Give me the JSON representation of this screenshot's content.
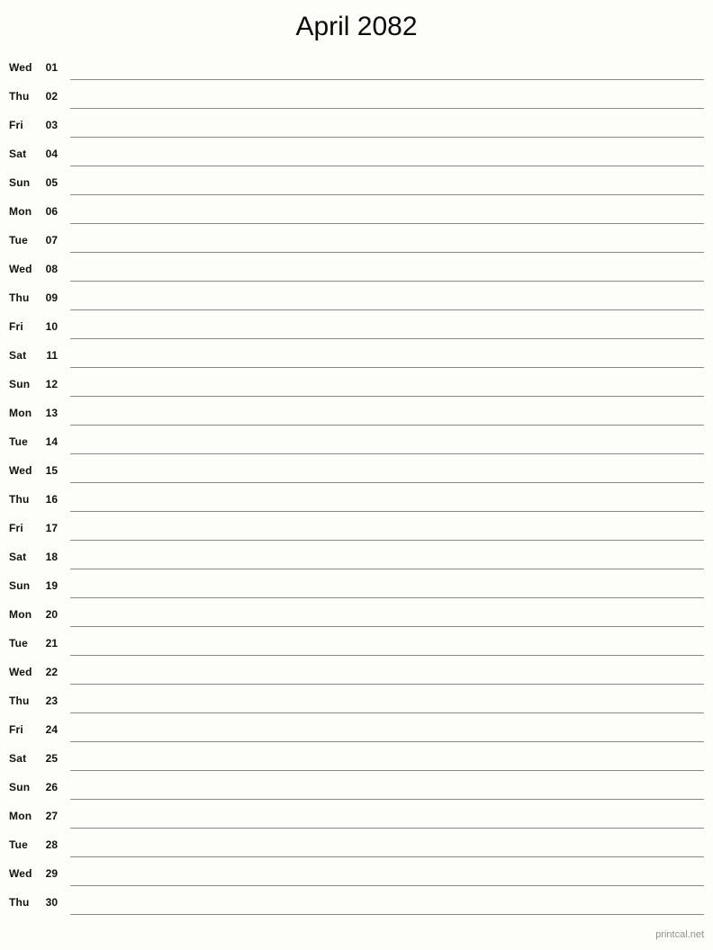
{
  "page": {
    "title": "April 2082",
    "background_color": "#fdfdfa",
    "rule_color": "#8a8a85",
    "text_color": "#111111",
    "footer_color": "#8f8f8f"
  },
  "footer": {
    "credit": "printcal.net"
  },
  "calendar": {
    "month_name": "April",
    "year": "2082",
    "days_in_month": 30,
    "first_weekday": "Wed",
    "rows": [
      {
        "weekday": "Wed",
        "day": "01"
      },
      {
        "weekday": "Thu",
        "day": "02"
      },
      {
        "weekday": "Fri",
        "day": "03"
      },
      {
        "weekday": "Sat",
        "day": "04"
      },
      {
        "weekday": "Sun",
        "day": "05"
      },
      {
        "weekday": "Mon",
        "day": "06"
      },
      {
        "weekday": "Tue",
        "day": "07"
      },
      {
        "weekday": "Wed",
        "day": "08"
      },
      {
        "weekday": "Thu",
        "day": "09"
      },
      {
        "weekday": "Fri",
        "day": "10"
      },
      {
        "weekday": "Sat",
        "day": "11"
      },
      {
        "weekday": "Sun",
        "day": "12"
      },
      {
        "weekday": "Mon",
        "day": "13"
      },
      {
        "weekday": "Tue",
        "day": "14"
      },
      {
        "weekday": "Wed",
        "day": "15"
      },
      {
        "weekday": "Thu",
        "day": "16"
      },
      {
        "weekday": "Fri",
        "day": "17"
      },
      {
        "weekday": "Sat",
        "day": "18"
      },
      {
        "weekday": "Sun",
        "day": "19"
      },
      {
        "weekday": "Mon",
        "day": "20"
      },
      {
        "weekday": "Tue",
        "day": "21"
      },
      {
        "weekday": "Wed",
        "day": "22"
      },
      {
        "weekday": "Thu",
        "day": "23"
      },
      {
        "weekday": "Fri",
        "day": "24"
      },
      {
        "weekday": "Sat",
        "day": "25"
      },
      {
        "weekday": "Sun",
        "day": "26"
      },
      {
        "weekday": "Mon",
        "day": "27"
      },
      {
        "weekday": "Tue",
        "day": "28"
      },
      {
        "weekday": "Wed",
        "day": "29"
      },
      {
        "weekday": "Thu",
        "day": "30"
      }
    ]
  }
}
